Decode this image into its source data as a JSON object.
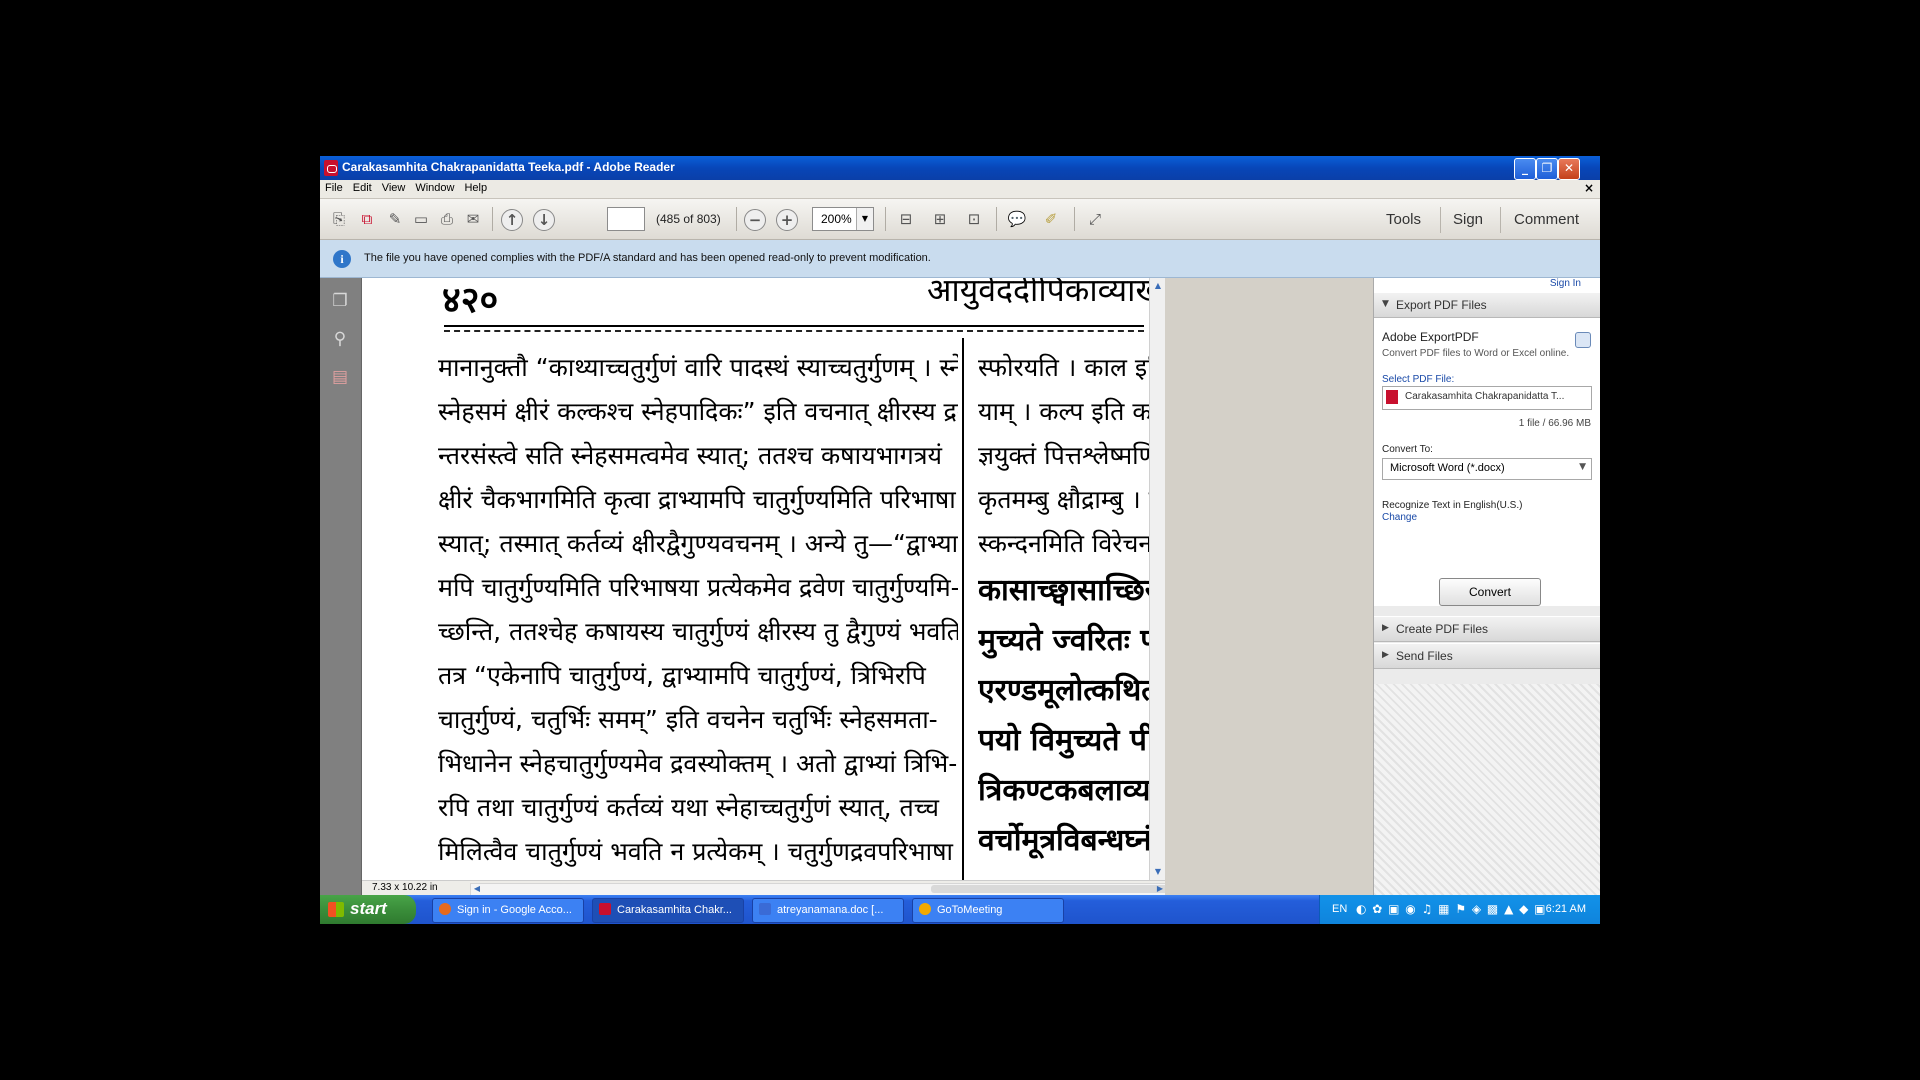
{
  "window": {
    "title": "Carakasamhita Chakrapanidatta Teeka.pdf - Adobe Reader"
  },
  "menu": [
    "File",
    "Edit",
    "View",
    "Window",
    "Help"
  ],
  "toolbar": {
    "page_count": "(485 of 803)",
    "zoom": "200%",
    "tabs": [
      "Tools",
      "Sign",
      "Comment"
    ]
  },
  "infobar": {
    "message": "The file you have opened complies with the PDF/A standard and has been opened read-only to prevent modification."
  },
  "document": {
    "page_number": "४२०",
    "header": "आयुर्वेददीपिकाव्याख्यासंवलिता",
    "left_lines": [
      "मानानुक्तौ “काथ्याच्चतुर्गुणं वारि पादस्थं स्याच्चतुर्गुणम् । स्नेहात्",
      "स्नेहसमं क्षीरं कल्कश्च स्नेहपादिकः” इति वचनात् क्षीरस्य द्रवा-",
      "न्तरसंस्त्वे सति स्नेहसमत्वमेव स्यात्; ततश्च कषायभागत्रयं",
      "क्षीरं चैकभागमिति कृत्वा द्राभ्यामपि चातुर्गुण्यमिति परिभाषा",
      "स्यात्; तस्मात् कर्तव्यं क्षीरद्वैगुण्यवचनम् । अन्ये तु—“द्वाभ्या-",
      "मपि चातुर्गुण्यमिति परिभाषया प्रत्येकमेव द्रवेण चातुर्गुण्यमि-",
      "च्छन्ति, ततश्चेह कषायस्य चातुर्गुण्यं क्षीरस्य तु द्वैगुण्यं भवति ।",
      "तत्र “एकेनापि चातुर्गुण्यं, द्वाभ्यामपि चातुर्गुण्यं, त्रिभिरपि",
      "चातुर्गुण्यं, चतुर्भिः समम्” इति वचनेन चतुर्भिः स्नेहसमता-",
      "भिधानेन स्नेहचातुर्गुण्यमेव द्रवस्योक्तम् । अतो द्वाभ्यां त्रिभि-",
      "रपि तथा चातुर्गुण्यं कर्तव्यं यथा स्नेहाच्चतुर्गुणं स्यात्, तच्च",
      "मिलित्वैव चातुर्गुण्यं भवति न प्रत्येकम् । चतुर्गुणद्रवपरिभाषा"
    ],
    "right_lines_small": [
      "स्फोरयति । काल इति",
      "याम् । कल्प इति कल्पस्थ",
      "ज्ञयुक्तं पित्तश्लेष्मणि, मधुक",
      "कृतमम्बु क्षौद्राम्बु । सैन्ध",
      "स्कन्दनमिति विरेचनम् ।"
    ],
    "right_lines_big": [
      "कासाच्छ्वासाच्छिरः",
      "मुच्यते ज्वरितः पीत",
      "एरण्डमूलोत्कथितं",
      "पयो विमुच्यते पीत",
      "त्रिकण्टकबलाव्याघ्री",
      "वर्चोमूत्रविबन्धघ्नं श"
    ],
    "page_size": "7.33 x 10.22 in"
  },
  "right_pane": {
    "sign_in": "Sign In",
    "export_title": "Export PDF Files",
    "service_name": "Adobe ExportPDF",
    "service_desc": "Convert PDF files to Word or Excel online.",
    "select_label": "Select PDF File:",
    "file_name": "Carakasamhita Chakrapanidatta T...",
    "file_info": "1 file / 66.96 MB",
    "convert_to_label": "Convert To:",
    "convert_to_value": "Microsoft Word (*.docx)",
    "recognize_label": "Recognize Text in English(U.S.)",
    "change_link": "Change",
    "convert_button": "Convert",
    "create_title": "Create PDF Files",
    "send_title": "Send Files"
  },
  "taskbar": {
    "start": "start",
    "tasks": [
      {
        "label": "Sign in - Google Acco...",
        "icon_color": "#e66a1d"
      },
      {
        "label": "Carakasamhita Chakr...",
        "icon_color": "#c8102e"
      },
      {
        "label": "atreyanamana.doc [...",
        "icon_color": "#3a6bd6"
      },
      {
        "label": "GoToMeeting",
        "icon_color": "#f2a900"
      }
    ],
    "lang": "EN",
    "clock": "6:21 AM"
  },
  "colors": {
    "title_blue": "#0846b8",
    "adobe_red": "#c8102e",
    "link_blue": "#1a4aa8"
  }
}
